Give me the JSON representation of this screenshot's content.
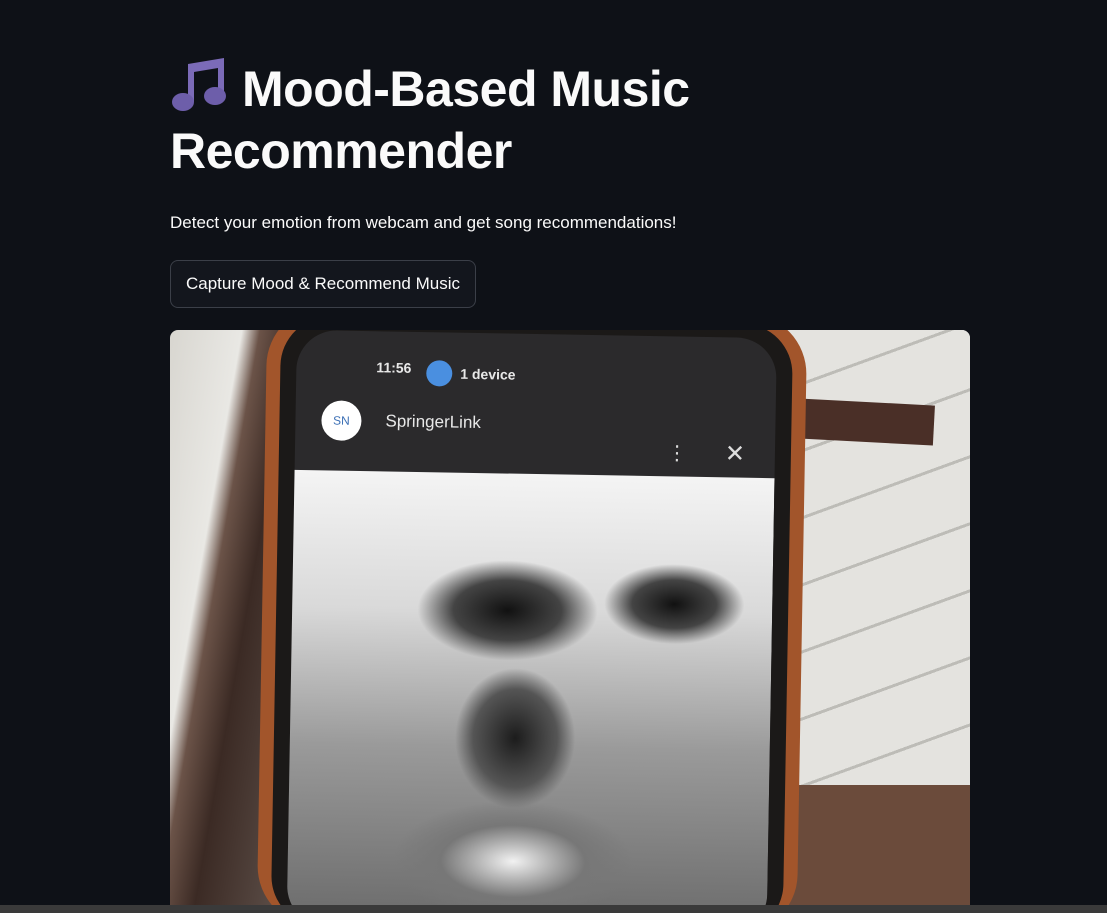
{
  "header": {
    "title": "Mood-Based Music Recommender",
    "icon": "musical-notes-icon",
    "icon_color": "#7b6bb8"
  },
  "subtitle": "Detect your emotion from webcam and get song recommendations!",
  "capture_button": {
    "label": "Capture Mood & Recommend Music"
  },
  "webcam_image": {
    "phone_status_time": "11:56",
    "phone_status_devices": "1 device",
    "site_avatar": "SN",
    "site_name": "SpringerLink"
  }
}
